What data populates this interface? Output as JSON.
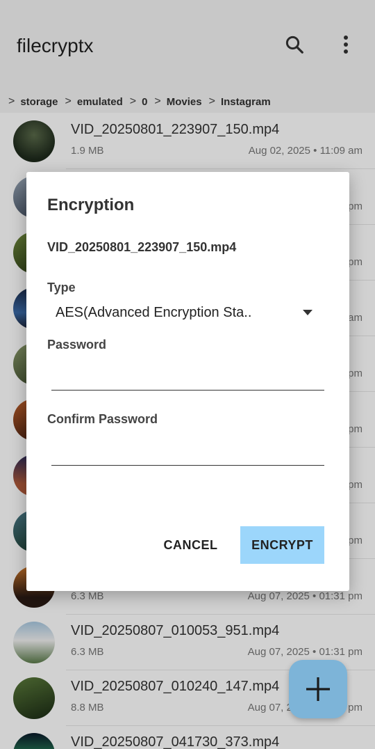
{
  "app": {
    "title": "filecryptx"
  },
  "breadcrumb": [
    "storage",
    "emulated",
    "0",
    "Movies",
    "Instagram"
  ],
  "files": [
    {
      "name": "VID_20250801_223907_150.mp4",
      "size": "1.9 MB",
      "date": "Aug 02, 2025 • 11:09 am"
    },
    {
      "name": "",
      "size": "",
      "date": "pm"
    },
    {
      "name": "",
      "size": "",
      "date": "pm"
    },
    {
      "name": "",
      "size": "",
      "date": "am"
    },
    {
      "name": "",
      "size": "",
      "date": "pm"
    },
    {
      "name": "",
      "size": "",
      "date": "pm"
    },
    {
      "name": "",
      "size": "",
      "date": "pm"
    },
    {
      "name": "",
      "size": "",
      "date": "pm"
    },
    {
      "name": "",
      "size": "6.3 MB",
      "date": "Aug 07, 2025 • 01:31 pm"
    },
    {
      "name": "VID_20250807_010053_951.mp4",
      "size": "6.3 MB",
      "date": "Aug 07, 2025 • 01:31 pm"
    },
    {
      "name": "VID_20250807_010240_147.mp4",
      "size": "8.8 MB",
      "date": "Aug 07, 2025 • 01:31 pm"
    },
    {
      "name": "VID_20250807_041730_373.mp4",
      "size": "",
      "date": ""
    }
  ],
  "dialog": {
    "title": "Encryption",
    "filename": "VID_20250801_223907_150.mp4",
    "type_label": "Type",
    "type_value": "AES(Advanced Encryption Sta..",
    "password_label": "Password",
    "confirm_label": "Confirm Password",
    "cancel": "CANCEL",
    "encrypt": "ENCRYPT"
  },
  "icons": {
    "search": "search-icon",
    "more": "more-vert-icon",
    "dropdown": "dropdown-arrow-icon",
    "add": "add-icon"
  },
  "colors": {
    "accent": "#9cd6fb",
    "fab": "#7db4d8",
    "appbar": "#f4f4f4"
  }
}
